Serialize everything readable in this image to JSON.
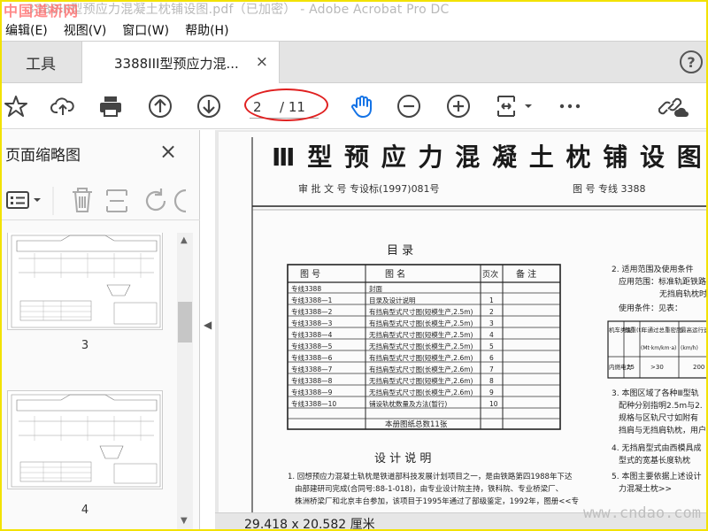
{
  "window": {
    "title": "3388III型预应力混凝土枕铺设图.pdf（已加密） - Adobe Acrobat Pro DC",
    "watermark_logo": "中国道桥网"
  },
  "menu": [
    "编辑(E)",
    "视图(V)",
    "窗口(W)",
    "帮助(H)"
  ],
  "tabs": {
    "tools_label": "工具",
    "doc_label": "3388III型预应力混...",
    "close_glyph": "×",
    "help_glyph": "?"
  },
  "toolbar": {
    "page_current": "2",
    "page_total": "/ 11",
    "icons": [
      "bookmark-star-icon",
      "upload-cloud-icon",
      "print-icon",
      "page-up-icon",
      "page-down-icon",
      "hand-tool-icon",
      "zoom-out-icon",
      "zoom-in-icon",
      "fit-page-icon",
      "more-icon",
      "share-link-icon"
    ]
  },
  "sidebar": {
    "title": "页面缩略图",
    "close_glyph": "×",
    "thumbnails": [
      {
        "label": "3"
      },
      {
        "label": "4"
      }
    ]
  },
  "document": {
    "heading": "Ⅲ 型 预 应 力 混 凝 土 枕 铺 设 图",
    "approval_line": "审 批 文 号   专设标(1997)081号",
    "drawing_no": "图   号   专线 3388",
    "toc_title": "目          录",
    "toc_headers": [
      "图   号",
      "图            名",
      "页次",
      "备   注"
    ],
    "toc_rows": [
      [
        "专线3388",
        "封面",
        ""
      ],
      [
        "专线3388—1",
        "目录及设计说明",
        "1"
      ],
      [
        "专线3388—2",
        "有挡肩型式尺寸图(短模生产,2.5m)",
        "2"
      ],
      [
        "专线3388—3",
        "有挡肩型式尺寸图(长模生产,2.5m)",
        "3"
      ],
      [
        "专线3388—4",
        "无挡肩型式尺寸图(短模生产,2.5m)",
        "4"
      ],
      [
        "专线3388—5",
        "无挡肩型式尺寸图(长模生产,2.5m)",
        "5"
      ],
      [
        "专线3388—6",
        "有挡肩型式尺寸图(短模生产,2.6m)",
        "6"
      ],
      [
        "专线3388—7",
        "有挡肩型式尺寸图(长模生产,2.6m)",
        "7"
      ],
      [
        "专线3388—8",
        "无挡肩型式尺寸图(短模生产,2.6m)",
        "8"
      ],
      [
        "专线3388—9",
        "无挡肩型式尺寸图(长模生产,2.6m)",
        "9"
      ],
      [
        "专线3388—10",
        "铺设轨枕数量及方法(暂行)",
        "10"
      ]
    ],
    "toc_footer": "本册图纸总数11张",
    "design_title": "设    计    说    明",
    "design_p1": "1. 回想预应力混凝土轨枕是铁道部科技发展计划项目之一，是由铁路第四1988年下达由部建研司完成(合同号:88-1-018)，由专业设计院主持，铁科院、专业桥梁厂、株洲桥梁厂和北京丰台参加，该项目于1995年通过了部级鉴定，1992年，图册<<专",
    "right_col": [
      "2. 适用范围及使用条件",
      "应用范围：标准轨距铁路",
      "无挡肩轨枕时",
      "使用条件：见表：",
      "3. 本图区域了各种Ⅲ型轨",
      "配种分别指明2.5m与2.",
      "规格与区轨尺寸如附有",
      "挡肩与无挡肩轨枕，用户",
      "4. 无挡肩型式由西模具成",
      "型式的宽基长度轨枕",
      "5. 本图主要依据上述设计",
      "力混凝土枕>>"
    ],
    "mini_table_headers": [
      "机车类型",
      "轴重(t)",
      "年通过总重密度",
      "最高运行速度"
    ],
    "mini_table_units": [
      "",
      "",
      "(Mt·km/km·a)",
      "(km/h)"
    ],
    "mini_table_row": [
      "内燃电力",
      "25",
      ">30",
      "200"
    ]
  },
  "status": {
    "page_size": "29.418 x 20.582 厘米",
    "site_watermark": "www.cndao.com"
  },
  "colors": {
    "accent": "#1473e6",
    "annotation": "#e02020",
    "watermark_frame": "#f2e200"
  }
}
